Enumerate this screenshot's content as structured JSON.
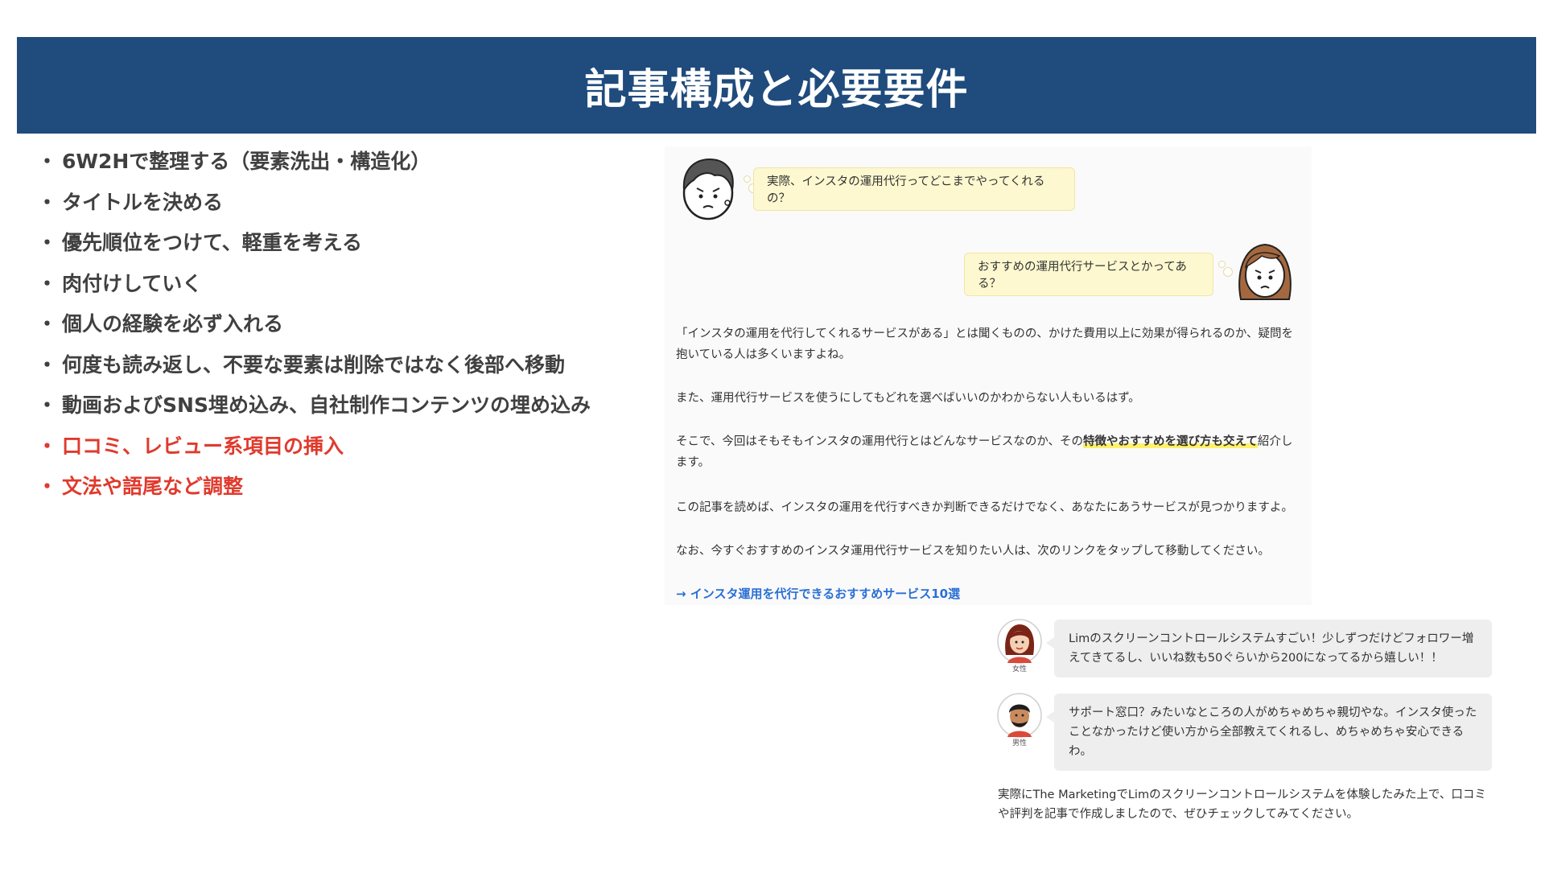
{
  "header": {
    "title": "記事構成と必要要件"
  },
  "bullets": [
    {
      "dot": "・",
      "text": "6W2Hで整理する（要素洗出・構造化）",
      "color": "#404040"
    },
    {
      "dot": "・",
      "text": "タイトルを決める",
      "color": "#404040"
    },
    {
      "dot": "・",
      "text": "優先順位をつけて、軽重を考える",
      "color": "#404040"
    },
    {
      "dot": "・",
      "text": "肉付けしていく",
      "color": "#404040"
    },
    {
      "dot": "・",
      "text": "個人の経験を必ず入れる",
      "color": "#404040"
    },
    {
      "dot": "・",
      "text": "何度も読み返し、不要な要素は削除ではなく後部へ移動",
      "color": "#404040"
    },
    {
      "dot": "・",
      "text": "動画およびSNS埋め込み、自社制作コンテンツの埋め込み",
      "color": "#404040"
    },
    {
      "dot": "・",
      "text": "口コミ、レビュー系項目の挿入",
      "color": "#e03a2d"
    },
    {
      "dot": "・",
      "text": "文法や語尾など調整",
      "color": "#e03a2d"
    }
  ],
  "article": {
    "bubble_1": "実際、インスタの運用代行ってどこまでやってくれるの？",
    "bubble_2": "おすすめの運用代行サービスとかってある？",
    "para_1": "「インスタの運用を代行してくれるサービスがある」とは聞くものの、かけた費用以上に効果が得られるのか、疑問を抱いている人は多くいますよね。",
    "para_2": "また、運用代行サービスを使うにしてもどれを選べばいいのかわからない人もいるはず。",
    "para_3_before": "そこで、今回はそもそもインスタの運用代行とはどんなサービスなのか、その",
    "para_3_highlight": "特徴やおすすめを選び方も交えて",
    "para_3_after": "紹介します。",
    "para_4": "この記事を読めば、インスタの運用を代行すべきか判断できるだけでなく、あなたにあうサービスが見つかりますよ。",
    "para_5": "なお、今すぐおすすめのインスタ運用代行サービスを知りたい人は、次のリンクをタップして移動してください。",
    "link": "→ インスタ運用を代行できるおすすめサービス10選"
  },
  "reviews": [
    {
      "caption": "女性",
      "text": "Limのスクリーンコントロールシステムすごい！少しずつだけどフォロワー増えてきてるし、いいね数も50ぐらいから200になってるから嬉しい！！"
    },
    {
      "caption": "男性",
      "text": "サポート窓口？みたいなところの人がめちゃめちゃ親切やな。インスタ使ったことなかったけど使い方から全部教えてくれるし、めちゃめちゃ安心できるわ。"
    }
  ],
  "closing": "実際にThe MarketingでLimのスクリーンコントロールシステムを体験したみた上で、口コミや評判を記事で作成しましたので、ぜひチェックしてみてください。",
  "icons": {
    "avatar_1": "worried-boy-avatar-icon",
    "avatar_2": "worried-girl-avatar-icon",
    "review_avatar_1": "woman-avatar-icon",
    "review_avatar_2": "man-avatar-icon"
  },
  "colors": {
    "header_bg": "#1f4b7d",
    "accent_red": "#e03a2d",
    "link_blue": "#2a6fd6",
    "bubble_yellow": "#fdf8cf"
  }
}
